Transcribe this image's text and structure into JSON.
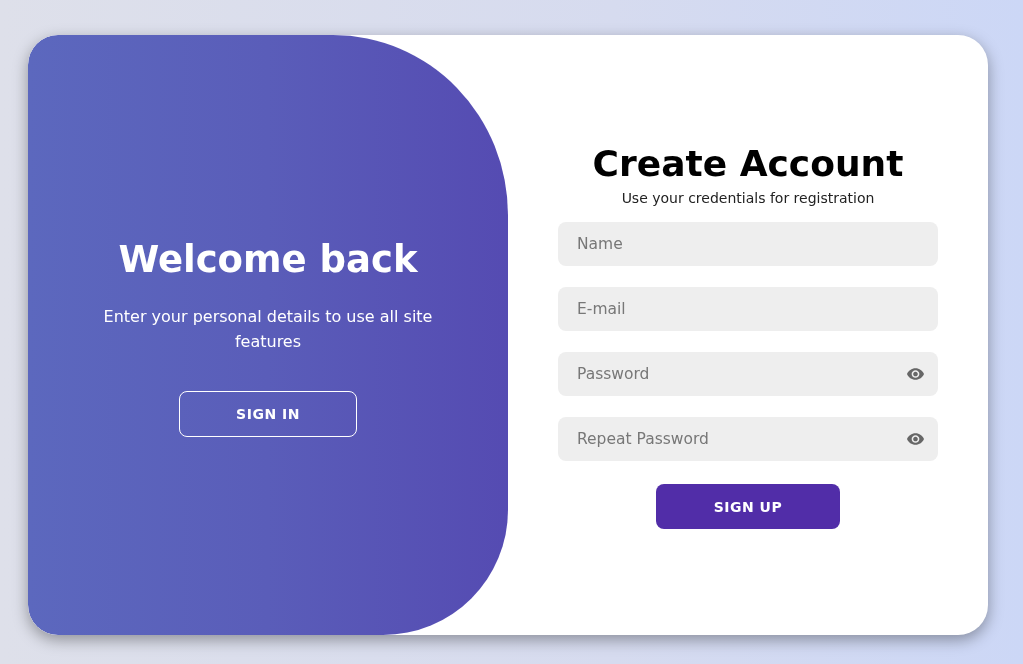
{
  "welcome_panel": {
    "title": "Welcome back",
    "text": "Enter your personal details to use all site features",
    "button": "SIGN IN"
  },
  "signup_form": {
    "title": "Create Account",
    "subtitle": "Use your credentials for registration",
    "fields": [
      {
        "kind": "text",
        "placeholder": "Name"
      },
      {
        "kind": "text",
        "placeholder": "E-mail"
      },
      {
        "kind": "password",
        "placeholder": "Password"
      },
      {
        "kind": "password",
        "placeholder": "Repeat Password"
      }
    ],
    "button": "SIGN UP"
  }
}
